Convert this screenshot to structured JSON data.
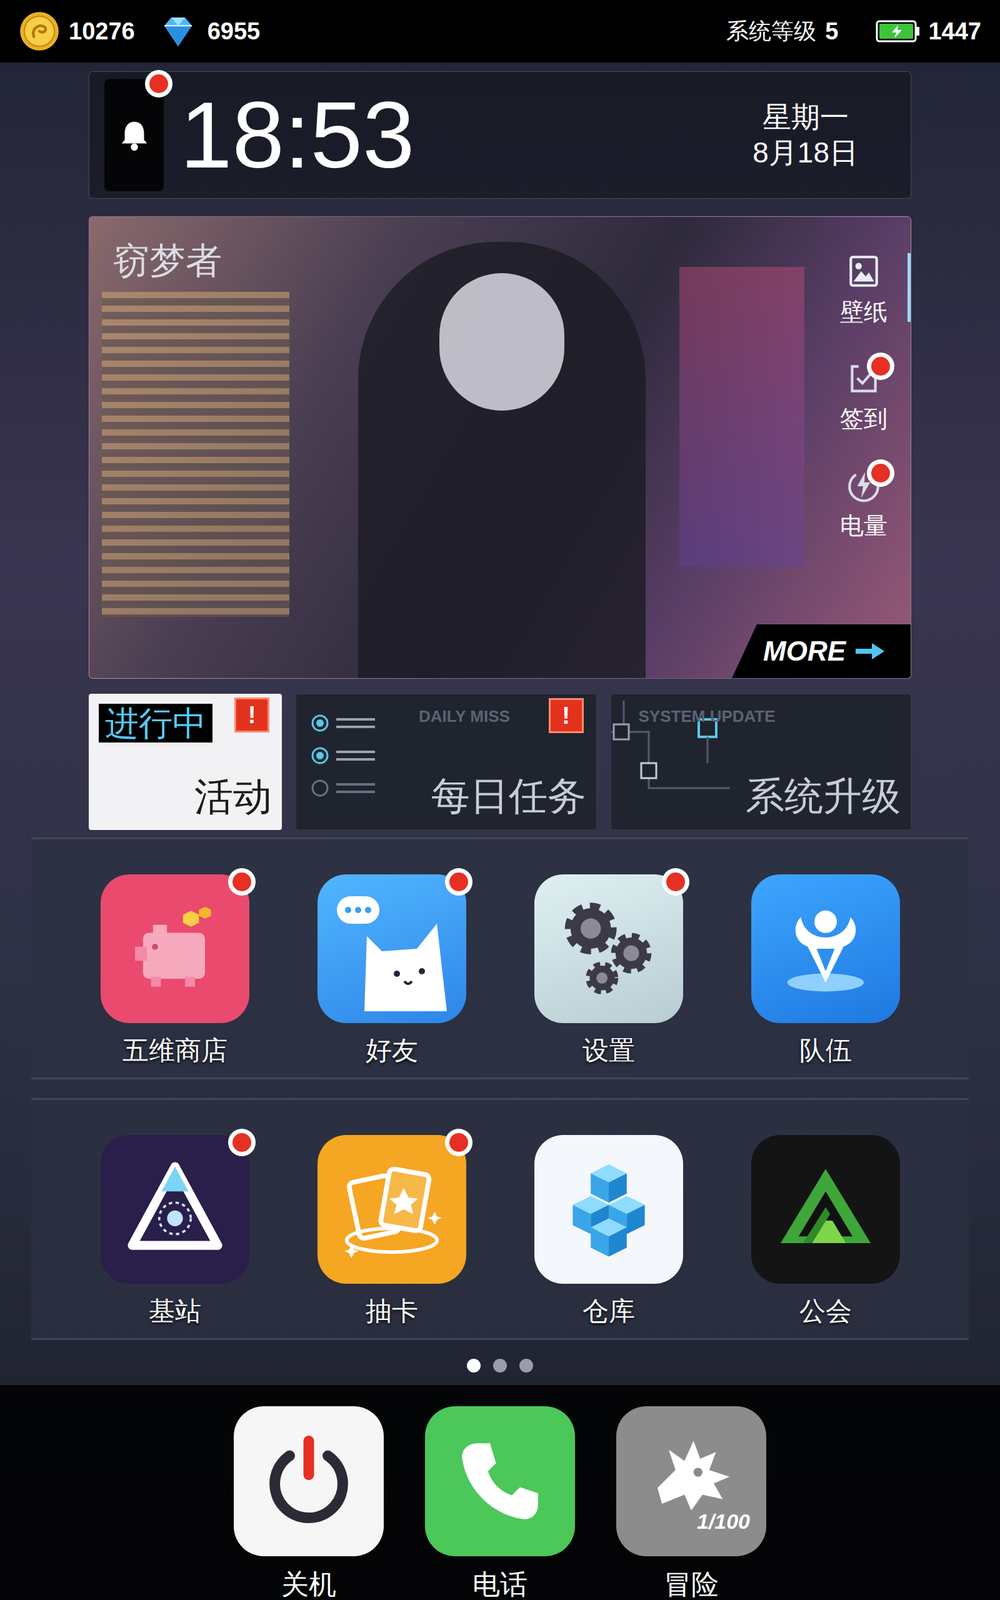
{
  "status_bar": {
    "coins": "10276",
    "gems": "6955",
    "level_label": "系统等级",
    "level": "5",
    "energy": "1447"
  },
  "clock": {
    "time": "18:53",
    "weekday": "星期一",
    "date": "8月18日",
    "notification": true
  },
  "wallpaper": {
    "title": "窃梦者",
    "more": "MORE",
    "actions": [
      {
        "label": "壁纸",
        "kind": "wallpaper",
        "selected": true,
        "badge": false
      },
      {
        "label": "签到",
        "kind": "checkin",
        "selected": false,
        "badge": true
      },
      {
        "label": "电量",
        "kind": "energy",
        "selected": false,
        "badge": true
      }
    ]
  },
  "tiles": [
    {
      "kind": "event",
      "tag": "进行中",
      "label": "活动",
      "alert": "!"
    },
    {
      "kind": "daily",
      "caption": "DAILY MISS",
      "label": "每日任务",
      "alert": "!"
    },
    {
      "kind": "update",
      "caption": "SYSTEM UPDATE",
      "label": "系统升级"
    }
  ],
  "shelves": [
    [
      {
        "label": "五维商店",
        "kind": "shop",
        "badge": true
      },
      {
        "label": "好友",
        "kind": "friends",
        "badge": true
      },
      {
        "label": "设置",
        "kind": "settings",
        "badge": true
      },
      {
        "label": "队伍",
        "kind": "team",
        "badge": false
      }
    ],
    [
      {
        "label": "基站",
        "kind": "base",
        "badge": true
      },
      {
        "label": "抽卡",
        "kind": "gacha",
        "badge": true
      },
      {
        "label": "仓库",
        "kind": "storage",
        "badge": false
      },
      {
        "label": "公会",
        "kind": "guild",
        "badge": false
      }
    ]
  ],
  "pager": [
    {
      "selected": true
    },
    {
      "selected": false
    },
    {
      "selected": false
    }
  ],
  "dock": [
    {
      "label": "关机",
      "kind": "power"
    },
    {
      "label": "电话",
      "kind": "phone"
    },
    {
      "label": "冒险",
      "kind": "adventure",
      "icon_text": "1/100"
    }
  ]
}
